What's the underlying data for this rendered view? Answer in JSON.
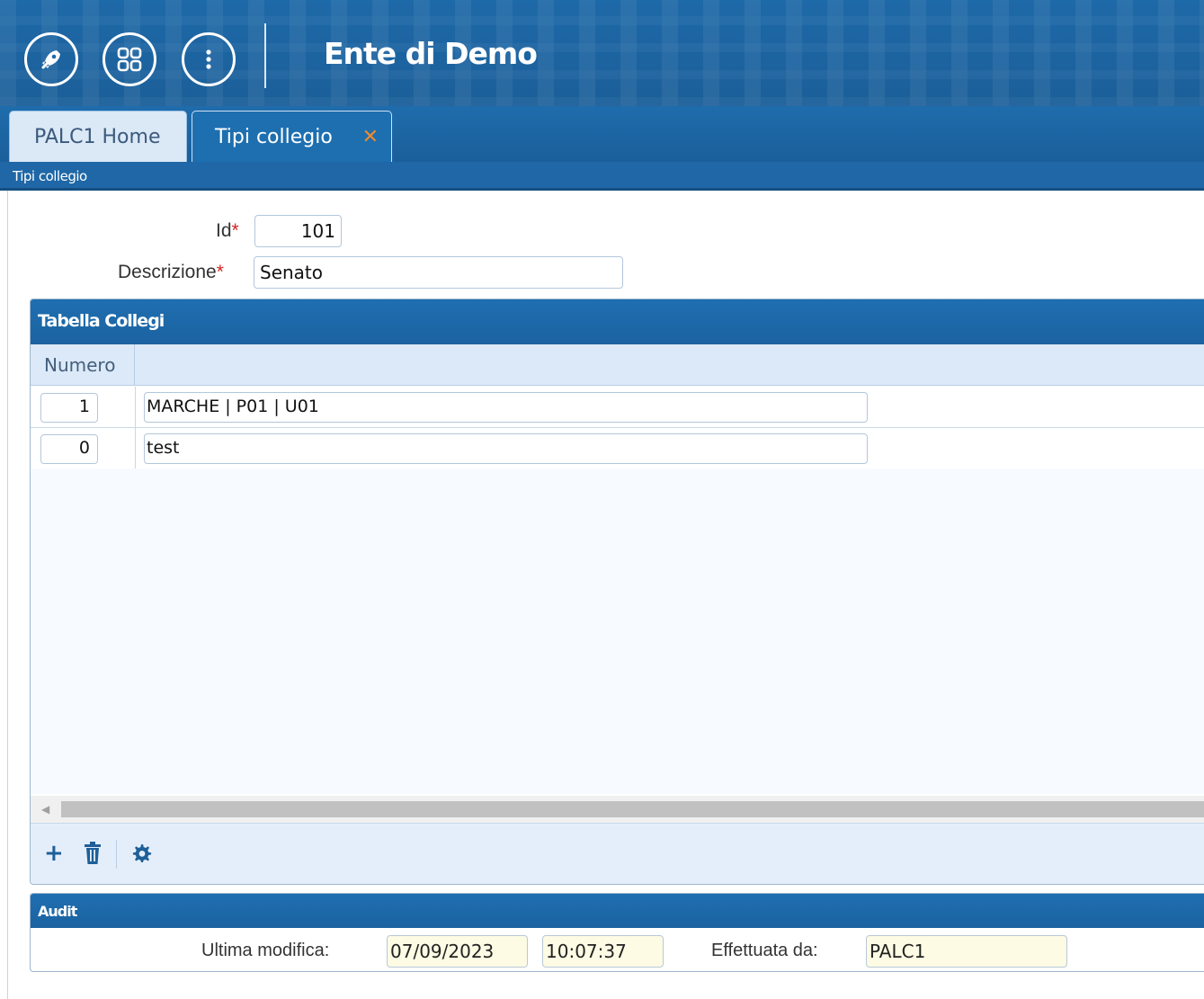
{
  "header": {
    "title": "Ente di Demo",
    "buttons": [
      {
        "icon": "rocket-icon"
      },
      {
        "icon": "apps-grid-icon"
      },
      {
        "icon": "more-vertical-icon"
      }
    ]
  },
  "tabs": [
    {
      "label": "PALC1 Home"
    },
    {
      "label": "Tipi collegio",
      "close": "✕"
    }
  ],
  "subtitle": "Tipi collegio",
  "form": {
    "id_label": "Id",
    "id_value": "101",
    "descr_label": "Descrizione",
    "descr_value": "Senato",
    "required_mark": "*"
  },
  "table": {
    "title": "Tabella Collegi",
    "col_numero": "Numero",
    "rows": [
      {
        "numero": "1",
        "descr": "MARCHE | P01 | U01"
      },
      {
        "numero": "0",
        "descr": "test"
      }
    ],
    "tools": {
      "add": "+",
      "delete": "trash-icon",
      "settings": "gear-icon"
    }
  },
  "audit": {
    "title": "Audit",
    "ultima_label": "Ultima modifica:",
    "date": "07/09/2023",
    "time": "10:07:37",
    "effettuata_label": "Effettuata da:",
    "user": "PALC1"
  },
  "colors": {
    "header_blue": "#1e69a8",
    "close_orange": "#f08a2a",
    "required_red": "#d32323"
  }
}
